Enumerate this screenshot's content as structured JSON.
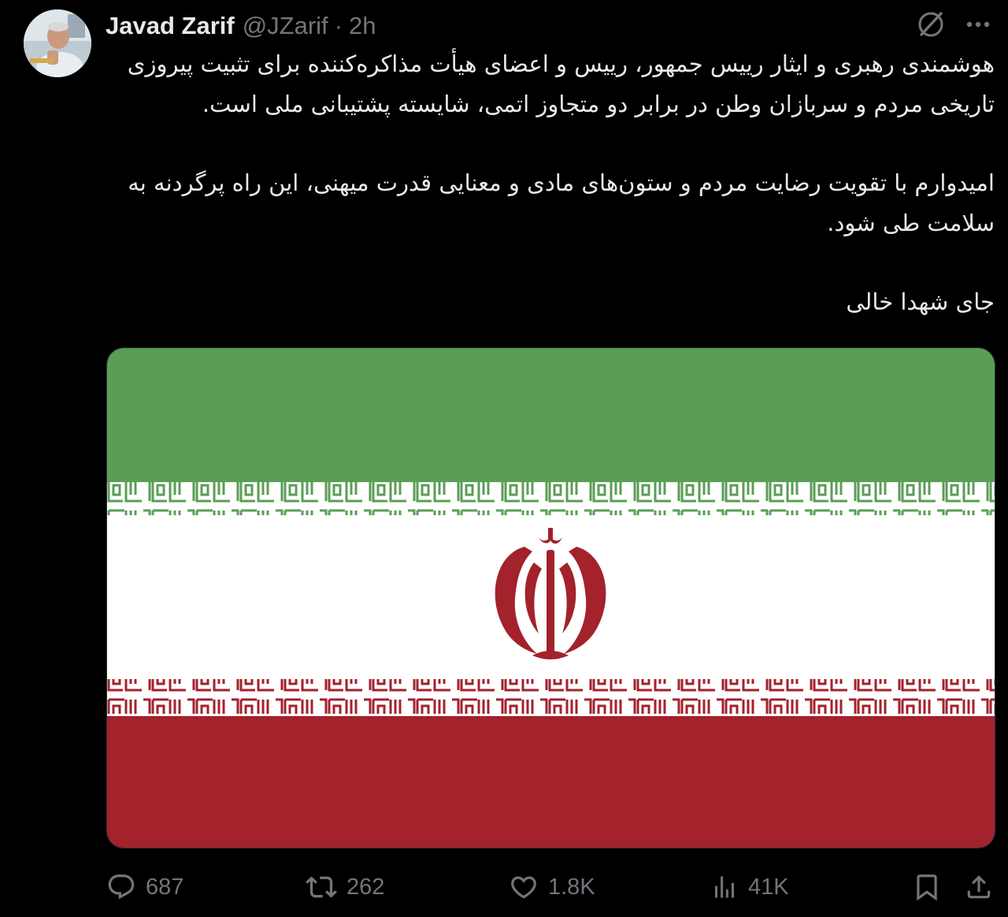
{
  "tweet": {
    "author_name": "Javad Zarif",
    "handle": "@JZarif",
    "separator": "·",
    "time": "2h",
    "paragraphs": [
      "هوشمندی رهبری و ایثار رییس جمهور، رییس و اعضای هیأت مذاکره‌کننده برای تثبیت پیروزی تاریخی مردم و سربازان وطن در برابر دو متجاوز اتمی، شایسته پشتیبانی ملی است.",
      "امیدوارم با تقویت رضایت مردم و ستون‌های مادی و معنایی قدرت میهنی، این راه پرگردنه به سلامت طی شود.",
      "جای شهدا خالی"
    ],
    "media": {
      "type": "image",
      "subject": "flag-of-iran",
      "colors": {
        "green": "#5a9e56",
        "white": "#ffffff",
        "red": "#a3222c"
      }
    }
  },
  "top_icons": {
    "grok": "grok-icon",
    "more": "more-icon"
  },
  "actions": {
    "replies": "687",
    "reposts": "262",
    "likes": "1.8K",
    "views": "41K"
  },
  "colors": {
    "background": "#000000",
    "text": "#e7e9ea",
    "muted": "#71767b"
  }
}
